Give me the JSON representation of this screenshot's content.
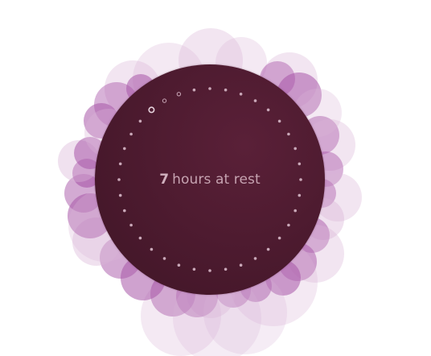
{
  "rest_summary": {
    "value": "7",
    "label": "hours at rest"
  },
  "dial": {
    "tick_count": 36,
    "current_tick_index": 32
  },
  "colors": {
    "main_circle": "#4e1b30",
    "bubble_strong": "#a855a8",
    "bubble_light": "#d9b5d6",
    "tick": "#c9a8b8",
    "label": "#c6a3b1"
  }
}
